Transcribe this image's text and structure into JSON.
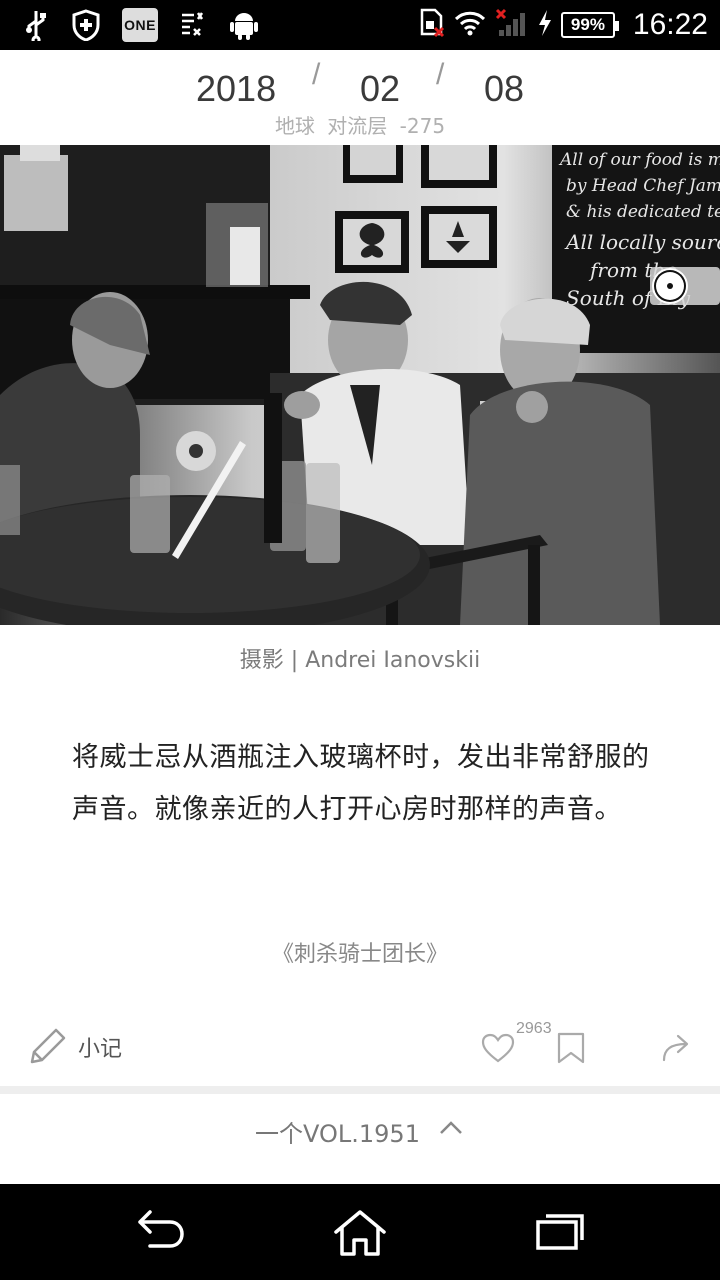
{
  "status_bar": {
    "battery": "99%",
    "time": "16:22",
    "app_badge": "ONE"
  },
  "header": {
    "year": "2018",
    "month": "02",
    "day": "08",
    "separator": "/",
    "location_1": "地球",
    "location_2": "对流层",
    "location_3": "-275"
  },
  "photo": {
    "credit": "摄影 | Andrei Ianovskii",
    "chalkboard_lines": [
      "All of our food is made",
      "by Head Chef James",
      "& his dedicated team",
      "All locally sourced",
      "from the",
      "South of Ely"
    ]
  },
  "content": {
    "quote": "将威士忌从酒瓶注入玻璃杯时，发出非常舒服的声音。就像亲近的人打开心房时那样的声音。",
    "source": "《刺杀骑士团长》"
  },
  "actions": {
    "note_label": "小记",
    "like_count": "2963"
  },
  "volume": {
    "label": "一个VOL.1951"
  },
  "icons": {
    "usb": "usb-icon",
    "shield": "shield-icon",
    "task": "task-list-icon",
    "android": "android-icon",
    "sim": "sim-icon",
    "wifi": "wifi-icon",
    "signal": "signal-icon",
    "charging": "charging-icon",
    "note": "pencil-icon",
    "like": "heart-icon",
    "bookmark": "bookmark-icon",
    "share": "share-icon",
    "chevron": "chevron-up-icon",
    "back": "back-icon",
    "home": "home-icon",
    "recents": "recents-icon"
  }
}
